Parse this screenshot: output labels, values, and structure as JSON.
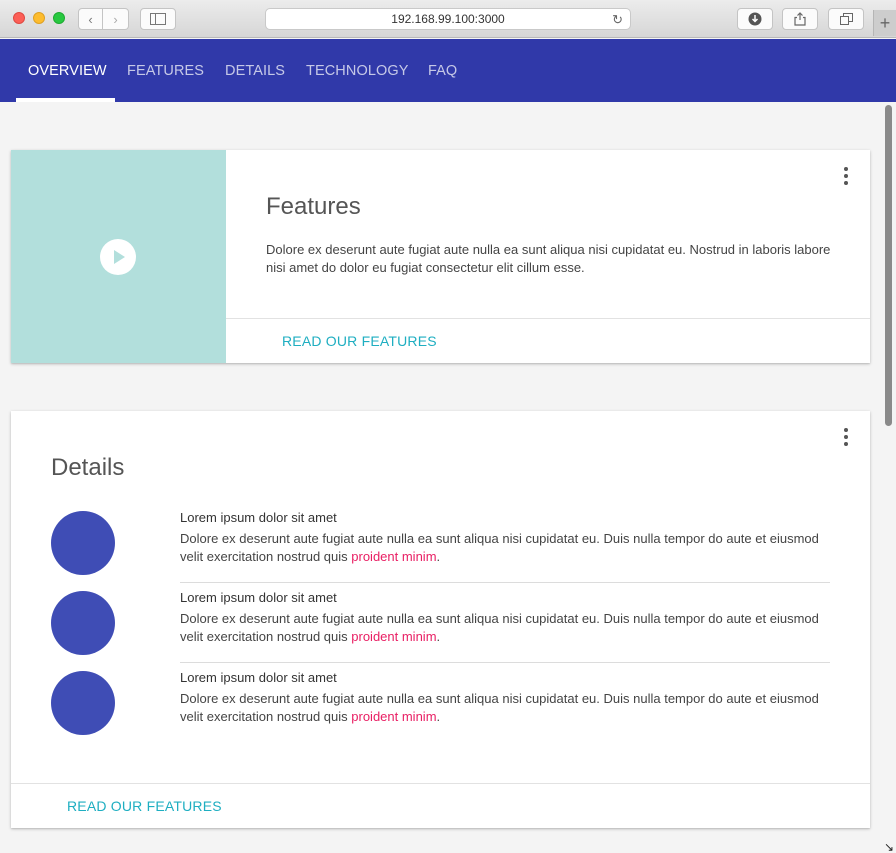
{
  "browser": {
    "url": "192.168.99.100:3000"
  },
  "nav": {
    "tabs": [
      {
        "label": "OVERVIEW",
        "active": true
      },
      {
        "label": "FEATURES",
        "active": false
      },
      {
        "label": "DETAILS",
        "active": false
      },
      {
        "label": "TECHNOLOGY",
        "active": false
      },
      {
        "label": "FAQ",
        "active": false
      }
    ]
  },
  "features_card": {
    "title": "Features",
    "body": "Dolore ex deserunt aute fugiat aute nulla ea sunt aliqua nisi cupidatat eu. Nostrud in laboris labore nisi amet do dolor eu fugiat consectetur elit cillum esse.",
    "action": "READ OUR FEATURES",
    "media_icon": "play-icon"
  },
  "details_card": {
    "title": "Details",
    "items": [
      {
        "title": "Lorem ipsum dolor sit amet",
        "text": "Dolore ex deserunt aute fugiat aute nulla ea sunt aliqua nisi cupidatat eu. Duis nulla tempor do aute et eiusmod velit exercitation nostrud quis ",
        "link": "proident minim",
        "end": "."
      },
      {
        "title": "Lorem ipsum dolor sit amet",
        "text": "Dolore ex deserunt aute fugiat aute nulla ea sunt aliqua nisi cupidatat eu. Duis nulla tempor do aute et eiusmod velit exercitation nostrud quis ",
        "link": "proident minim",
        "end": "."
      },
      {
        "title": "Lorem ipsum dolor sit amet",
        "text": "Dolore ex deserunt aute fugiat aute nulla ea sunt aliqua nisi cupidatat eu. Duis nulla tempor do aute et eiusmod velit exercitation nostrud quis ",
        "link": "proident minim",
        "end": "."
      }
    ],
    "action": "READ OUR FEATURES"
  },
  "colors": {
    "appbar": "#3039a9",
    "accent": "#1eaec1",
    "avatar": "#3f4db5",
    "link": "#e91e63",
    "media": "#b2dfdc"
  }
}
